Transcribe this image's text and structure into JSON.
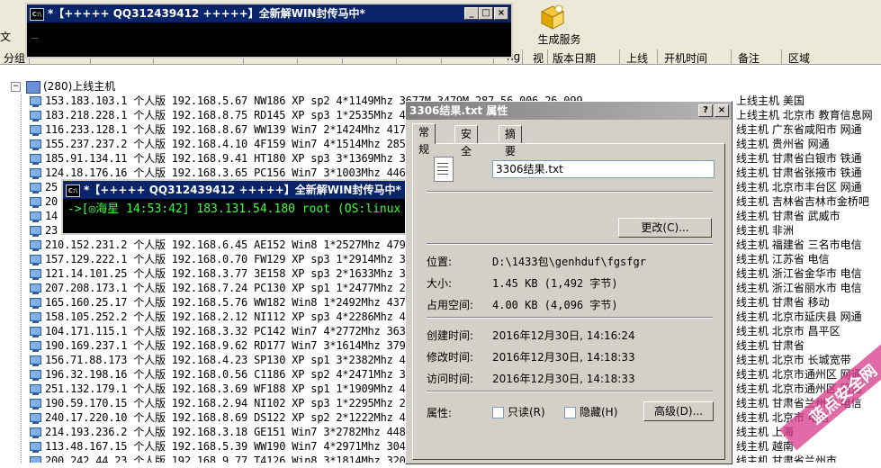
{
  "toolbar": {
    "left_fragment": "文",
    "generate_label": "生成服务端"
  },
  "columns": [
    "分组",
    "",
    "",
    "",
    "",
    "",
    "",
    "",
    "ng",
    "视",
    "版本日期",
    "上线",
    "开机时间",
    "备注",
    "区域"
  ],
  "tree": {
    "root_label": "(280)上线主机",
    "rows": [
      {
        "text": "153.183.103.1 个人版 192.168.5.67 NW186 XP sp2 4*1149Mhz 3677M 3479M 287.56.006.26.099",
        "right": "上线主机    美国"
      },
      {
        "text": "183.218.228.1 个人版 192.168.8.75 RD145 XP sp3 1*2535Mhz 4080M 396",
        "right": "上线主机 北京市  教育信息网"
      },
      {
        "text": "116.233.128.1 个人版 192.168.8.67 WW139 Win7 2*1424Mhz 4174M 4027M",
        "right": "线主机 广东省咸阳市  网通"
      },
      {
        "text": "155.237.237.2 个人版 192.168.4.10 4F159 Win7 4*1514Mhz 2857M 2705M",
        "right": "线主机 贵州省       网通"
      },
      {
        "text": "185.91.134.11 个人版 192.168.9.41 HT180 XP sp3 3*1369Mhz 3159M 297",
        "right": "线主机 甘肃省白银市  铁通"
      },
      {
        "text": "124.18.176.16 个人版 192.168.3.65 PC156 Win7 3*1003Mhz 4460M 4320M",
        "right": "线主机 甘肃省张掖市  铁通"
      },
      {
        "text": "25",
        "right": "线主机 北京市丰台区  网通"
      },
      {
        "text": "20",
        "right": "线主机 吉林省吉林市金桥吧"
      },
      {
        "text": "14",
        "right": "线主机 甘肃省      武威市"
      },
      {
        "text": "23",
        "right": "线主机       非洲"
      },
      {
        "text": "210.152.231.2 个人版 192.168.6.45 AE152 Win8 1*2527Mhz 4799M 4673M",
        "right": "线主机 福建省   三名市电信"
      },
      {
        "text": "157.129.222.1 个人版 192.168.0.70 FW129 XP sp3 1*2914Mhz 3025M 284",
        "right": "线主机 江苏省       电信"
      },
      {
        "text": "121.14.101.25 个人版 192.168.3.77 3E158 XP sp3 2*1633Mhz 3655M 351",
        "right": "线主机 浙江省金华市  电信"
      },
      {
        "text": "207.208.173.1 个人版 192.168.7.24 PC130 XP sp1 1*2477Mhz 2750M 263",
        "right": "线主机 浙江省丽水市  电信"
      },
      {
        "text": "165.160.25.17 个人版 192.168.5.76 WW182 Win8 1*2492Mhz 4379M 4205M",
        "right": "线主机 甘肃省       移动"
      },
      {
        "text": "158.105.252.2 个人版 192.168.2.12 NI112 XP sp3 4*2286Mhz 4459M 433",
        "right": "线主机 北京市延庆县  网通"
      },
      {
        "text": "104.171.115.1 个人版 192.168.3.32 PC142 Win7 4*2772Mhz 3633M 3519M",
        "right": "线主机 北京市     昌平区"
      },
      {
        "text": "190.169.237.1 个人版 192.168.9.62 RD177 Win7 3*1614Mhz 3796M 3650M",
        "right": "线主机 甘肃省"
      },
      {
        "text": "156.71.88.173 个人版 192.168.4.23 SP130 XP sp1 3*2382Mhz 4357M 425",
        "right": "线主机 北京市     长城宽带"
      },
      {
        "text": "196.32.198.16 个人版 192.168.0.56 C1186 XP sp2 4*2471Mhz 3040M 293",
        "right": "线主机 北京市通州区  网通"
      },
      {
        "text": "251.132.179.1 个人版 192.168.3.69 WF188 XP sp1 1*1909Mhz 4678M 453",
        "right": "线主机 北京市通州区  网通"
      },
      {
        "text": "190.59.170.15 个人版 192.168.2.94 NI102 XP sp3 1*2295Mhz 2904M 280",
        "right": "线主机 甘肃省兰州市  电信"
      },
      {
        "text": "240.17.220.10 个人版 192.168.8.69 DS122 XP sp2 2*1222Mhz 4791M 460",
        "right": "线主机 北京市     电信"
      },
      {
        "text": "214.193.236.2 个人版 192.168.3.18 GE151 Win7 3*2782Mhz 4483M 4311M",
        "right": "线主机 上海"
      },
      {
        "text": "113.48.167.15 个人版 192.168.5.39 WW190 Win7 4*2971Mhz 3045M 2881M",
        "right": "线主机      越南"
      },
      {
        "text": "200.242.44.23 个人版 192.168.9.77 T4126 Win8 3*1814Mhz 3208M 3069M",
        "right": "线主机 甘肃省兰州市"
      }
    ]
  },
  "console1": {
    "title": "*【+++++  QQ312439412  +++++】全新解WIN封传马中*",
    "line": "_"
  },
  "console2": {
    "title": "*【+++++  QQ312439412  +++++】全新解WIN封传马中*",
    "line": "->[◎海星 14:53:42] 183.131.54.180 root  (OS:linux Ver:5.1.73)"
  },
  "dialog": {
    "title": "3306结果.txt 属性",
    "tabs": [
      "常规",
      "安全",
      "摘要"
    ],
    "filename": "3306结果.txt",
    "change_button": "更改(C)...",
    "location_label": "位置:",
    "location_value": "D:\\1433包\\genhduf\\fgsfgr",
    "size_label": "大小:",
    "size_value": "1.45 KB (1,492 字节)",
    "disk_label": "占用空间:",
    "disk_value": "4.00 KB (4,096 字节)",
    "created_label": "创建时间:",
    "created_value": "2016年12月30日, 14:16:24",
    "modified_label": "修改时间:",
    "modified_value": "2016年12月30日, 14:18:33",
    "accessed_label": "访问时间:",
    "accessed_value": "2016年12月30日, 14:18:33",
    "attr_label": "属性:",
    "readonly_label": "只读(R)",
    "hidden_label": "隐藏(H)",
    "advanced_button": "高级(D)..."
  },
  "watermark": {
    "text": "蓝点安全网"
  }
}
